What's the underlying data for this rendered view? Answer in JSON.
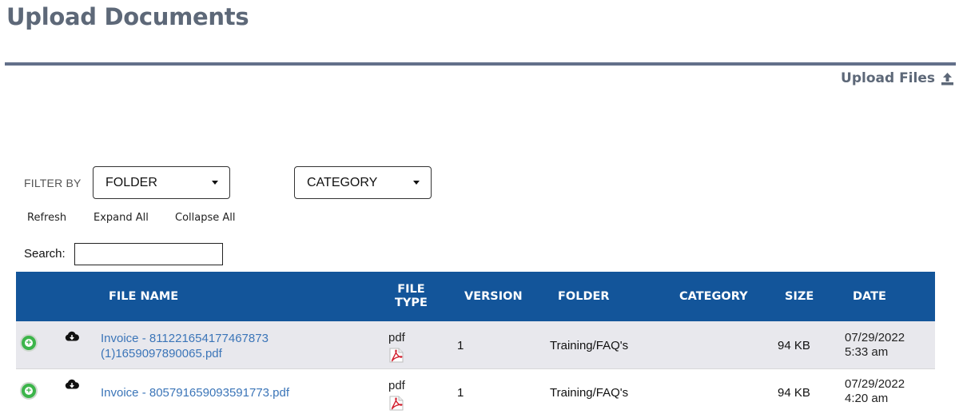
{
  "page": {
    "title": "Upload Documents",
    "upload_files_label": "Upload Files",
    "upload_icon": "upload-icon"
  },
  "filters": {
    "label": "FILTER BY",
    "folder": {
      "selected": "FOLDER"
    },
    "category": {
      "selected": "CATEGORY"
    }
  },
  "actions": {
    "refresh": "Refresh",
    "expand_all": "Expand All",
    "collapse_all": "Collapse All"
  },
  "search": {
    "label": "Search:",
    "value": ""
  },
  "table": {
    "columns": {
      "file_name": "FILE NAME",
      "file_type_line1": "FILE",
      "file_type_line2": "TYPE",
      "version": "VERSION",
      "folder": "FOLDER",
      "category": "CATEGORY",
      "size": "SIZE",
      "date": "DATE"
    },
    "rows": [
      {
        "file_name_line1": "Invoice - 811221654177467873",
        "file_name_line2": "(1)1659097890065.pdf",
        "file_type": "pdf",
        "version": "1",
        "folder": "Training/FAQ's",
        "category": "",
        "size": "94 KB",
        "date": "07/29/2022",
        "time": "5:33 am"
      },
      {
        "file_name_line1": "Invoice - 805791659093591773.pdf",
        "file_name_line2": "",
        "file_type": "pdf",
        "version": "1",
        "folder": "Training/FAQ's",
        "category": "",
        "size": "94 KB",
        "date": "07/29/2022",
        "time": "4:20 am"
      }
    ]
  },
  "colors": {
    "header_bg": "#13559a",
    "title_text": "#5d6878",
    "link": "#3b75b8",
    "expand_green": "#3cb54a",
    "row_alt": "#e8e8ed"
  }
}
